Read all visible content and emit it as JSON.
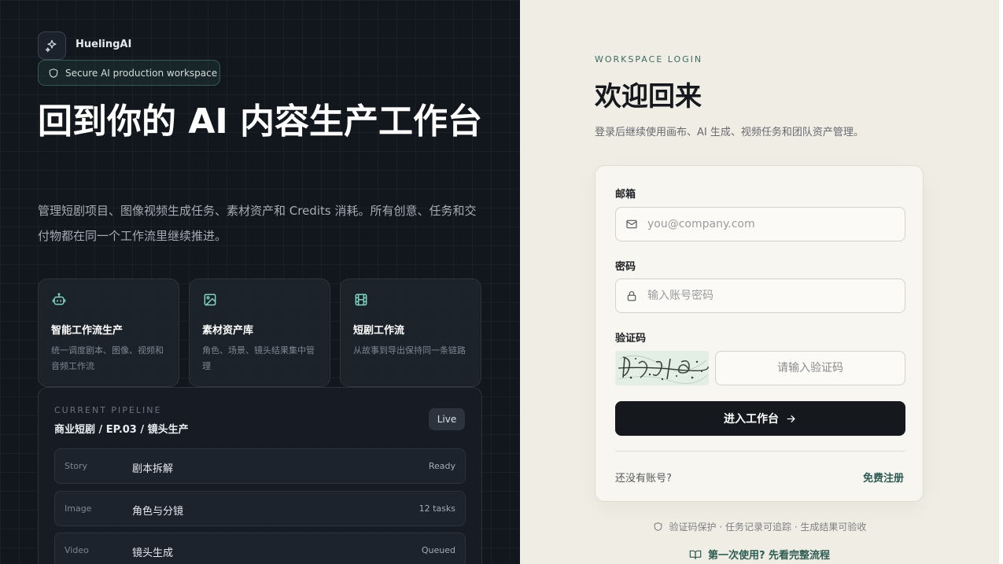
{
  "brand": {
    "name": "HuelingAI",
    "icon": "sparkles-icon"
  },
  "hero": {
    "badge": "Secure AI production workspace",
    "title": "回到你的 AI 内容生产工作台",
    "description": "管理短剧项目、图像视频生成任务、素材资产和 Credits 消耗。所有创意、任务和交付物都在同一个工作流里继续推进。"
  },
  "features": [
    {
      "icon": "robot-icon",
      "title": "智能工作流生产",
      "desc": "统一调度剧本、图像、视频和音频工作流"
    },
    {
      "icon": "image-icon",
      "title": "素材资产库",
      "desc": "角色、场景、镜头结果集中管理"
    },
    {
      "icon": "film-icon",
      "title": "短剧工作流",
      "desc": "从故事到导出保持同一条链路"
    }
  ],
  "pipeline": {
    "label": "CURRENT PIPELINE",
    "title": "商业短剧 / EP.03 / 镜头生产",
    "badge": "Live",
    "rows": [
      {
        "stage": "Story",
        "task": "剧本拆解",
        "status": "Ready"
      },
      {
        "stage": "Image",
        "task": "角色与分镜",
        "status": "12 tasks"
      },
      {
        "stage": "Video",
        "task": "镜头生成",
        "status": "Queued"
      }
    ]
  },
  "login": {
    "eyebrow": "WORKSPACE LOGIN",
    "title": "欢迎回来",
    "subtitle": "登录后继续使用画布、AI 生成、视频任务和团队资产管理。",
    "email_label": "邮箱",
    "email_placeholder": "you@company.com",
    "password_label": "密码",
    "password_placeholder": "输入账号密码",
    "captcha_label": "验证码",
    "captcha_placeholder": "请输入验证码",
    "submit": "进入工作台",
    "no_account": "还没有账号?",
    "register": "免费注册"
  },
  "footer": {
    "note": "验证码保护 · 任务记录可追踪 · 生成结果可验收",
    "first_use": "第一次使用? 先看完整流程"
  },
  "colors": {
    "left_bg": "#12161d",
    "right_bg": "#f0ede4",
    "accent": "#2d5c53",
    "primary_button": "#15181c",
    "icon_accent": "#7ed2c1"
  }
}
